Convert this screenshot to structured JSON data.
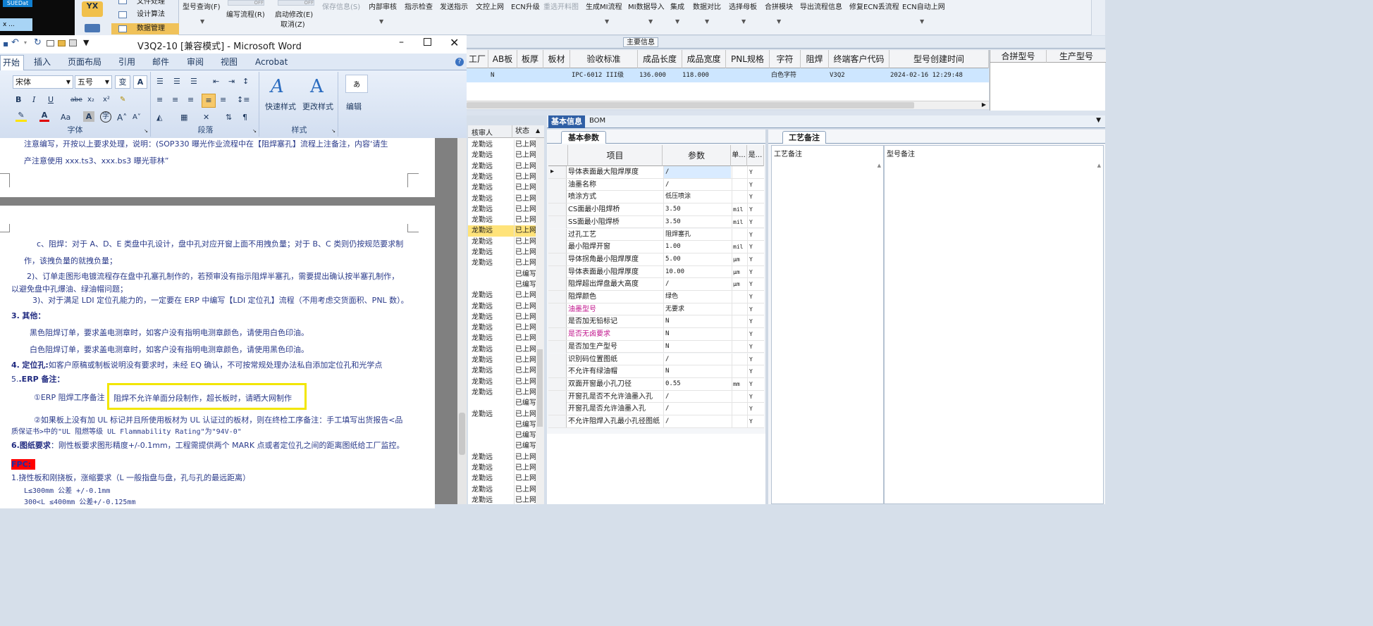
{
  "erp": {
    "toolbar": {
      "row1": [
        {
          "label": "型号查询(F)",
          "disabled": false
        },
        {
          "label": "保存信息(S)",
          "disabled": true
        },
        {
          "label": "内部审核",
          "disabled": false
        },
        {
          "label": "指示检查",
          "disabled": false
        },
        {
          "label": "发送指示",
          "disabled": false
        },
        {
          "label": "文控上网",
          "disabled": false
        },
        {
          "label": "ECN升级",
          "disabled": false
        },
        {
          "label": "重选开料图",
          "disabled": true
        },
        {
          "label": "生成MI流程",
          "disabled": false
        },
        {
          "label": "MI数据导入",
          "disabled": false
        },
        {
          "label": "集成",
          "disabled": false
        },
        {
          "label": "数据对比",
          "disabled": false
        },
        {
          "label": "选择母板",
          "disabled": false
        },
        {
          "label": "合拼模块",
          "disabled": false
        },
        {
          "label": "导出流程信息",
          "disabled": false
        },
        {
          "label": "修复ECN丢流程",
          "disabled": false
        },
        {
          "label": "ECN自动上网",
          "disabled": false
        }
      ],
      "edit_flow": "编写流程(R)",
      "start_edit": "启动修改(E)",
      "cancel": "取消(Z)",
      "off1": "OFF",
      "off2": "OFF"
    },
    "nav": {
      "dark_item": "SUEDat",
      "dark_item2": "x ...",
      "logo_text": "YX",
      "items": [
        "文件处理",
        "设计算法",
        "数据管理"
      ],
      "active_index": 2
    },
    "info_label": "主要信息",
    "grid": {
      "headers": [
        "工厂",
        "AB板",
        "板厚",
        "板材",
        "验收标准",
        "成品长度",
        "成品宽度",
        "PNL规格",
        "字符",
        "阻焊",
        "终端客户代码",
        "型号创建时间"
      ],
      "row": [
        "",
        "N",
        "",
        "",
        "IPC-6012 III级",
        "136.000",
        "118.000",
        "",
        "白色字符",
        "",
        "V3Q2",
        "2024-02-16 12:29:48"
      ],
      "merge_headers": [
        "合拼型号",
        "生产型号"
      ]
    },
    "reviewer": {
      "headers": [
        "核审人",
        "状态"
      ],
      "rows": [
        [
          "龙勤远",
          "已上网"
        ],
        [
          "龙勤远",
          "已上网"
        ],
        [
          "龙勤远",
          "已上网"
        ],
        [
          "龙勤远",
          "已上网"
        ],
        [
          "龙勤远",
          "已上网"
        ],
        [
          "龙勤远",
          "已上网"
        ],
        [
          "龙勤远",
          "已上网"
        ],
        [
          "龙勤远",
          "已上网"
        ],
        [
          "龙勤远",
          "已上网"
        ],
        [
          "龙勤远",
          "已上网"
        ],
        [
          "龙勤远",
          "已上网"
        ],
        [
          "龙勤远",
          "已上网"
        ],
        [
          "",
          "已编写"
        ],
        [
          "",
          "已编写"
        ],
        [
          "龙勤远",
          "已上网"
        ],
        [
          "龙勤远",
          "已上网"
        ],
        [
          "龙勤远",
          "已上网"
        ],
        [
          "龙勤远",
          "已上网"
        ],
        [
          "龙勤远",
          "已上网"
        ],
        [
          "龙勤远",
          "已上网"
        ],
        [
          "龙勤远",
          "已上网"
        ],
        [
          "龙勤远",
          "已上网"
        ],
        [
          "龙勤远",
          "已上网"
        ],
        [
          "龙勤远",
          "已上网"
        ],
        [
          "",
          "已编写"
        ],
        [
          "龙勤远",
          "已上网"
        ],
        [
          "",
          "已编写"
        ],
        [
          "",
          "已编写"
        ],
        [
          "",
          "已编写"
        ],
        [
          "龙勤远",
          "已上网"
        ],
        [
          "龙勤远",
          "已上网"
        ],
        [
          "龙勤远",
          "已上网"
        ],
        [
          "龙勤远",
          "已上网"
        ],
        [
          "龙勤远",
          "已上网"
        ],
        [
          "龙勤远",
          "已上网"
        ]
      ],
      "highlight_index": 8
    },
    "tabs": [
      "基本信息",
      "BOM"
    ],
    "basic": {
      "title": "基本参数",
      "headers": [
        "项目",
        "参数",
        "单...",
        "是..."
      ],
      "rows": [
        {
          "k": "导体表面最大阻焊厚度",
          "v": "/",
          "u": "",
          "y": "Y",
          "c": ""
        },
        {
          "k": "油墨名称",
          "v": "/",
          "u": "",
          "y": "Y",
          "c": ""
        },
        {
          "k": "喷涂方式",
          "v": "低压喷涂",
          "u": "",
          "y": "Y",
          "c": ""
        },
        {
          "k": "CS面最小阻焊桥",
          "v": "3.50",
          "u": "mil",
          "y": "Y",
          "c": ""
        },
        {
          "k": "SS面最小阻焊桥",
          "v": "3.50",
          "u": "mil",
          "y": "Y",
          "c": ""
        },
        {
          "k": "过孔工艺",
          "v": "阻焊塞孔",
          "u": "",
          "y": "Y",
          "c": ""
        },
        {
          "k": "最小阻焊开窗",
          "v": "1.00",
          "u": "mil",
          "y": "Y",
          "c": ""
        },
        {
          "k": "导体拐角最小阻焊厚度",
          "v": "5.00",
          "u": "μm",
          "y": "Y",
          "c": ""
        },
        {
          "k": "导体表面最小阻焊厚度",
          "v": "10.00",
          "u": "μm",
          "y": "Y",
          "c": ""
        },
        {
          "k": "阻焊超出焊盘最大高度",
          "v": "/",
          "u": "μm",
          "y": "Y",
          "c": ""
        },
        {
          "k": "阻焊颜色",
          "v": "绿色",
          "u": "",
          "y": "Y",
          "c": ""
        },
        {
          "k": "油墨型号",
          "v": "无要求",
          "u": "",
          "y": "Y",
          "c": "pink"
        },
        {
          "k": "是否加无铅标记",
          "v": "N",
          "u": "",
          "y": "Y",
          "c": ""
        },
        {
          "k": "是否无卤要求",
          "v": "N",
          "u": "",
          "y": "Y",
          "c": "pink"
        },
        {
          "k": "是否加生产型号",
          "v": "N",
          "u": "",
          "y": "Y",
          "c": ""
        },
        {
          "k": "识别码位置图纸",
          "v": "/",
          "u": "",
          "y": "Y",
          "c": ""
        },
        {
          "k": "不允许有绿油帽",
          "v": "N",
          "u": "",
          "y": "Y",
          "c": ""
        },
        {
          "k": "双面开窗最小孔刀径",
          "v": "0.55",
          "u": "mm",
          "y": "Y",
          "c": ""
        },
        {
          "k": "开窗孔是否不允许油墨入孔",
          "v": "/",
          "u": "",
          "y": "Y",
          "c": ""
        },
        {
          "k": "开窗孔是否允许油墨入孔",
          "v": "/",
          "u": "",
          "y": "Y",
          "c": ""
        },
        {
          "k": "不允许阻焊入孔最小孔径图纸",
          "v": "/",
          "u": "",
          "y": "Y",
          "c": ""
        }
      ]
    },
    "process": {
      "title": "工艺备注",
      "headers": [
        "工艺备注",
        "型号备注"
      ]
    }
  },
  "word": {
    "title": "V3Q2-10 [兼容模式] - Microsoft Word",
    "tabs": [
      "开始",
      "插入",
      "页面布局",
      "引用",
      "邮件",
      "审阅",
      "视图",
      "Acrobat"
    ],
    "font_name": "宋体",
    "font_size": "五号",
    "group_labels": [
      "字体",
      "段落",
      "样式"
    ],
    "quick_style": "快速样式",
    "change_style": "更改样式",
    "edit": "编辑",
    "doc": {
      "top_line1": "注意编写，开按以上要求处理，说明：(SOP330 曝光作业流程中在【阻焊塞孔】流程上注备注，内容‘请生",
      "top_line2": "产注意使用 xxx.ts3、xxx.bs3 曝光菲林”",
      "l_c1": "c、阻焊：对于 A、D、E 类盘中孔设计，盘中孔对应开窗上面不用拽负量；对于 B、C 类则仍按规范要求制",
      "l_c2": "作，该拽负量的就拽负量；",
      "l_2a": "2)、订单走图形电镀流程存在盘中孔塞孔制作的，若预审没有指示阻焊半塞孔，需要提出确认按半塞孔制作，",
      "l_2b": "以避免盘中孔爆油、绿油帽问题；",
      "l_3": "3)、对于满足 LDI 定位孔能力的，一定要在 ERP 中编写【LDI 定位孔】流程（不用考虑交货面积、PNL 数）。",
      "h3_num": "3.",
      "h3_txt": "其他：",
      "l_black": "黑色阻焊订单，要求盖电测章时，如客户没有指明电测章颜色，请使用白色印油。",
      "l_white": "白色阻焊订单，要求盖电测章时，如客户没有指明电测章颜色，请使用黑色印油。",
      "h4_num": "4.",
      "h4_bold": "定位孔:",
      "h4_txt": "如客户原稿或制板说明没有要求时，未经 EQ 确认，不可按常规处理办法私自添加定位孔和光学点",
      "h5_num": "5.",
      "h5_txt": ".ERP 备注：",
      "erp1_a": "①ERP 阻焊工序备注",
      "erp1_b": "阻焊不允许单面分段制作，超长板时，请晒大网制作",
      "erp2_a": "②如果板上没有加 UL 标记并且所使用板材为 UL 认证过的板材，则在终检工序备注：手工填写出货报告<品",
      "erp2_b": "质保证书>中的\"UL 阻燃等级 UL Flammability Rating\"为\"94V-0\"",
      "h6_bold": "6.图纸要求",
      "h6_txt": "：刚性板要求图形精度+/-0.1mm，工程需提供两个 MARK 点或者定位孔之间的距离图纸给工厂监控。",
      "fpc": "FPC:",
      "l_fpc1": "1.挠性板和刚挠板，涨缩要求（L 一般指盘与盘，孔与孔的最远距离）",
      "l_fpc2": "L≤300mm 公差 +/-0.1mm",
      "l_fpc3": "300<L ≤400mm 公差+/-0.125mm"
    }
  }
}
